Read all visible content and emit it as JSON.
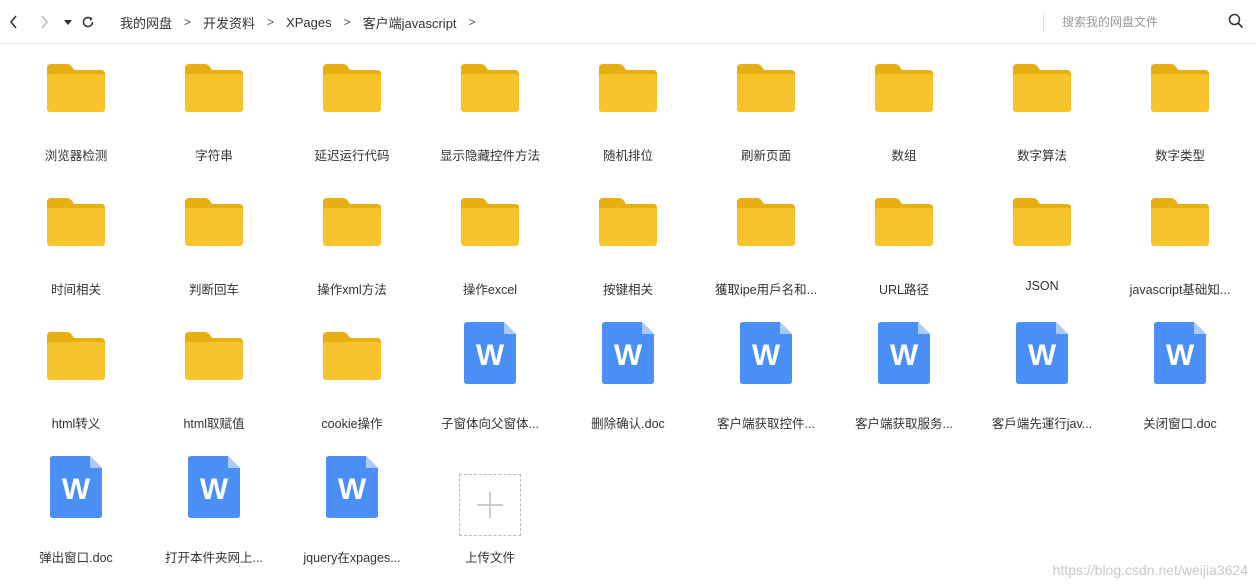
{
  "toolbar": {
    "breadcrumb": [
      "我的网盘",
      "开发资料",
      "XPages",
      "客户端javascript"
    ],
    "separator": ">",
    "search_placeholder": "搜索我的网盘文件"
  },
  "colors": {
    "folder": "#F7C52B",
    "folder_tab": "#E8AF12",
    "doc": "#4A90F4",
    "doc_fold": "#A9CAFB"
  },
  "items": [
    {
      "type": "folder",
      "label": "浏览器检测"
    },
    {
      "type": "folder",
      "label": "字符串"
    },
    {
      "type": "folder",
      "label": "延迟运行代码"
    },
    {
      "type": "folder",
      "label": "显示隐藏控件方法"
    },
    {
      "type": "folder",
      "label": "随机排位"
    },
    {
      "type": "folder",
      "label": "刷新页面"
    },
    {
      "type": "folder",
      "label": "数组"
    },
    {
      "type": "folder",
      "label": "数字算法"
    },
    {
      "type": "folder",
      "label": "数字类型"
    },
    {
      "type": "folder",
      "label": "时间相关"
    },
    {
      "type": "folder",
      "label": "判断回车"
    },
    {
      "type": "folder",
      "label": "操作xml方法"
    },
    {
      "type": "folder",
      "label": "操作excel"
    },
    {
      "type": "folder",
      "label": "按键相关"
    },
    {
      "type": "folder",
      "label": "獲取ipe用戶名和..."
    },
    {
      "type": "folder",
      "label": "URL路径"
    },
    {
      "type": "folder",
      "label": "JSON"
    },
    {
      "type": "folder",
      "label": "javascript基础知..."
    },
    {
      "type": "folder",
      "label": "html转义"
    },
    {
      "type": "folder",
      "label": "html取赋值"
    },
    {
      "type": "folder",
      "label": "cookie操作"
    },
    {
      "type": "doc",
      "label": "子窗体向父窗体..."
    },
    {
      "type": "doc",
      "label": "删除确认.doc"
    },
    {
      "type": "doc",
      "label": "客户端获取控件..."
    },
    {
      "type": "doc",
      "label": "客户端获取服务..."
    },
    {
      "type": "doc",
      "label": "客戶端先運行jav..."
    },
    {
      "type": "doc",
      "label": "关闭窗口.doc"
    },
    {
      "type": "doc",
      "label": "弹出窗口.doc"
    },
    {
      "type": "doc",
      "label": "打开本件夹网上..."
    },
    {
      "type": "doc",
      "label": "jquery在xpages..."
    },
    {
      "type": "upload",
      "label": "上传文件"
    }
  ],
  "doc_letter": "W",
  "watermark": "https://blog.csdn.net/weijia3624"
}
